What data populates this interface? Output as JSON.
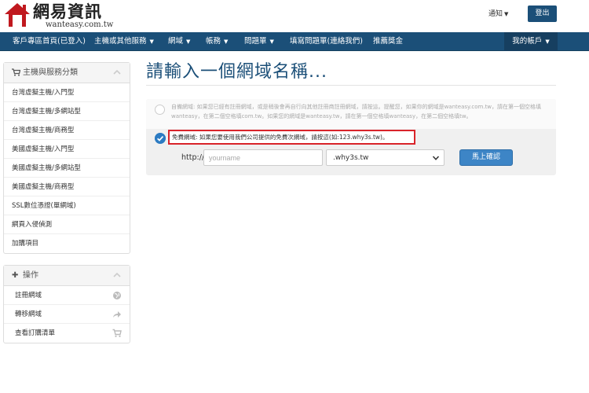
{
  "brand": {
    "name": "網易資訊",
    "domain": "wanteasy.com.tw"
  },
  "header": {
    "notify_label": "通知",
    "logout_label": "登出"
  },
  "nav": {
    "items": [
      {
        "label": "客戶專區首頁(已登入)",
        "dropdown": false
      },
      {
        "label": "主機或其他服務",
        "dropdown": true
      },
      {
        "label": "網域",
        "dropdown": true
      },
      {
        "label": "帳務",
        "dropdown": true
      },
      {
        "label": "問題單",
        "dropdown": true
      },
      {
        "label": "填寫問題單(連絡我們)",
        "dropdown": false
      },
      {
        "label": "推薦獎金",
        "dropdown": false
      }
    ],
    "account_label": "我的帳戶"
  },
  "sidebar": {
    "categories": {
      "title": "主機與服務分類",
      "icon": "cart-icon",
      "items": [
        {
          "label": "台灣虛擬主機/入門型"
        },
        {
          "label": "台灣虛擬主機/多網站型"
        },
        {
          "label": "台灣虛擬主機/商務型"
        },
        {
          "label": "美國虛擬主機/入門型"
        },
        {
          "label": "美國虛擬主機/多網站型"
        },
        {
          "label": "美國虛擬主機/商務型"
        },
        {
          "label": "SSL數位憑證(單網域)"
        },
        {
          "label": "網頁入侵偵測"
        },
        {
          "label": "加購項目"
        }
      ]
    },
    "actions": {
      "title": "操作",
      "icon": "plus-icon",
      "items": [
        {
          "label": "註冊網域",
          "icon": "globe-icon"
        },
        {
          "label": "轉移網域",
          "icon": "share-icon"
        },
        {
          "label": "查看訂購清單",
          "icon": "cart-icon"
        }
      ]
    }
  },
  "main": {
    "title": "請輸入一個網域名稱...",
    "other_domain_option": {
      "selected": false,
      "text": "自備網域: 如果您已經有註冊網域，或是稍後會再自行向其他註冊商註冊網域，請按這。提醒您，如果你的網域是wanteasy.com.tw，請在第一個空格填wanteasy，在第二個空格填com.tw。如果您的網域是wanteasy.tw，請在第一個空格填wanteasy，在第二個空格填tw。"
    },
    "free_domain_option": {
      "selected": true,
      "text": "免費網域: 如果您要使用我們公司提供的免費次網域，請按這(如:123.why3s.tw)。"
    },
    "form": {
      "prefix_label": "http://",
      "domain_placeholder": "yourname",
      "domain_value": "",
      "suffix_selected": ".why3s.tw",
      "submit_label": "馬上確認"
    }
  },
  "colors": {
    "brand_blue": "#1b4f78",
    "account_bg": "#163f60",
    "title_blue": "#1b4f78",
    "button_blue": "#3d85c6",
    "highlight_red": "#d9242a",
    "check_blue": "#2c7bc2"
  }
}
